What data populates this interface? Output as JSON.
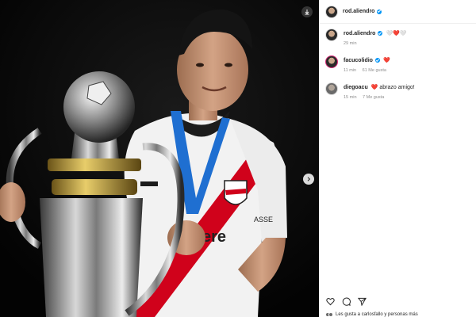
{
  "post": {
    "author": "rod.aliendro",
    "verified": true
  },
  "comments": [
    {
      "user": "rod.aliendro",
      "verified": true,
      "text": "🤍❤️🤍",
      "time": "29 min",
      "likes": ""
    },
    {
      "user": "facucolidio",
      "verified": true,
      "text": "❤️",
      "time": "11 min",
      "likes": "61 Me gusta"
    },
    {
      "user": "diegoacu",
      "verified": false,
      "text": "❤️ abrazo amigo!",
      "time": "15 min",
      "likes": "7 Me gusta"
    }
  ],
  "footer": {
    "likes_text": "Les gusta a carlosfallo y personas más"
  },
  "icons": {
    "download": "download-icon",
    "next": "chevron-right-icon",
    "like": "heart-icon",
    "comment": "comment-icon",
    "share": "send-icon"
  },
  "colors": {
    "verified": "#0095f6",
    "heart": "#ed4956",
    "jersey_red": "#d0021b"
  }
}
